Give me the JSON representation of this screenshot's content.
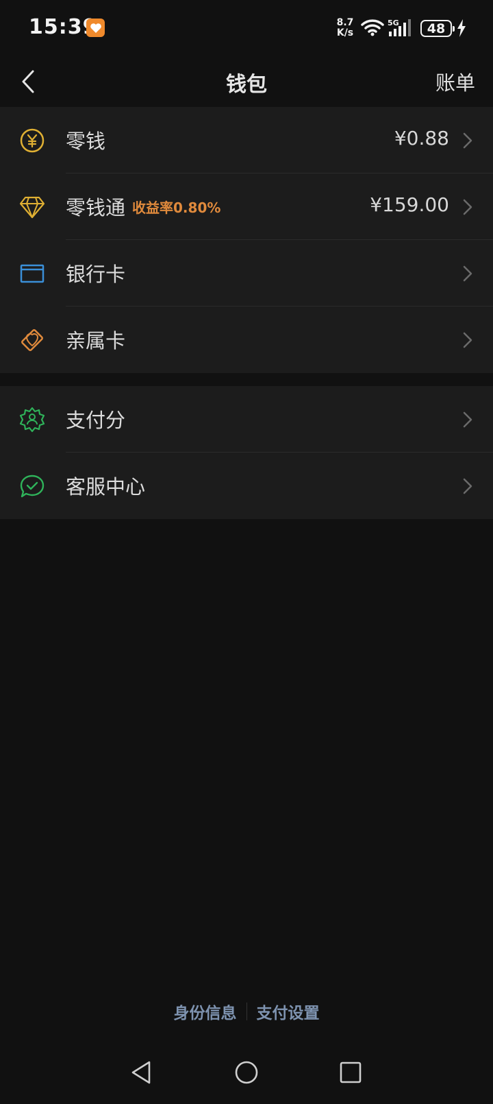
{
  "status_bar": {
    "time": "15:39",
    "net_speed_value": "8.7",
    "net_speed_unit": "K/s",
    "network_type": "5G",
    "battery": "48"
  },
  "header": {
    "title": "钱包",
    "right_action": "账单"
  },
  "groups": [
    {
      "items": [
        {
          "label": "零钱",
          "tag": "",
          "value": "¥0.88",
          "icon": "yuan-coin-icon",
          "color": "#e0b033"
        },
        {
          "label": "零钱通",
          "tag": "收益率0.80%",
          "value": "¥159.00",
          "icon": "diamond-icon",
          "color": "#e0b033"
        },
        {
          "label": "银行卡",
          "tag": "",
          "value": "",
          "icon": "bank-card-icon",
          "color": "#3a8fd8"
        },
        {
          "label": "亲属卡",
          "tag": "",
          "value": "",
          "icon": "family-card-icon",
          "color": "#e08a3c"
        }
      ]
    },
    {
      "items": [
        {
          "label": "支付分",
          "tag": "",
          "value": "",
          "icon": "pay-score-icon",
          "color": "#2fb35a"
        },
        {
          "label": "客服中心",
          "tag": "",
          "value": "",
          "icon": "customer-service-icon",
          "color": "#2fb35a"
        }
      ]
    }
  ],
  "footer": {
    "links": [
      "身份信息",
      "支付设置"
    ]
  },
  "colors": {
    "background": "#111111",
    "card": "#1c1c1c",
    "accent_orange": "#e08a3c",
    "link_blue": "#7e93b0"
  }
}
